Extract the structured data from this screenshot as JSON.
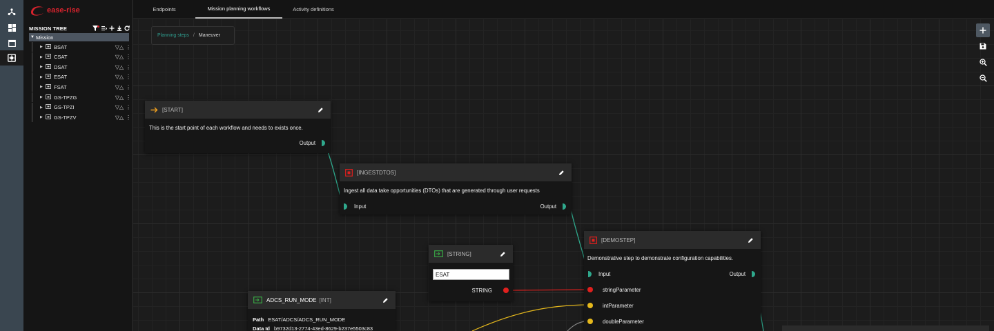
{
  "app": {
    "logo_text": "ease-rise",
    "brand_color": "#d9232d",
    "accent_color": "#2fa88c"
  },
  "rail": {
    "items": [
      {
        "icon": "hierarchy-icon",
        "active": false
      },
      {
        "icon": "dashboard-icon",
        "active": false
      },
      {
        "icon": "calendar-icon",
        "active": false
      },
      {
        "icon": "workflow-icon",
        "active": true
      }
    ]
  },
  "tree": {
    "title": "MISSION TREE",
    "root": "Mission",
    "items": [
      {
        "label": "BSAT"
      },
      {
        "label": "CSAT"
      },
      {
        "label": "DSAT"
      },
      {
        "label": "ESAT"
      },
      {
        "label": "FSAT"
      },
      {
        "label": "GS-TPZG"
      },
      {
        "label": "GS-TPZI"
      },
      {
        "label": "GS-TPZV"
      }
    ],
    "flag_glyphs": "▽△",
    "more_glyph": "⋮"
  },
  "tabs": [
    {
      "label": "Endpoints",
      "active": false
    },
    {
      "label": "Mission planning workflows",
      "active": true
    },
    {
      "label": "Activity definitions",
      "active": false
    }
  ],
  "breadcrumb": {
    "parent": "Planning steps",
    "separator": "/",
    "current": "Maneuver"
  },
  "nodes": {
    "start": {
      "title": "[START]",
      "description": "This is the start point of each workflow and needs to exists once.",
      "output": "Output"
    },
    "ingest": {
      "title": "[INGESTDTOS]",
      "description": "Ingest all data take opportunities (DTOs) that are generated through user requests",
      "input": "Input",
      "output": "Output"
    },
    "string": {
      "title": "[STRING]",
      "value": "ESAT",
      "output": "STRING"
    },
    "demostep": {
      "title": "[DEMOSTEP]",
      "description": "Demonstrative step to demonstrate configuration capabilities.",
      "input": "Input",
      "output": "Output",
      "params": [
        {
          "label": "stringParameter",
          "color": "#e0201e"
        },
        {
          "label": "intParameter",
          "color": "#e5b81c"
        },
        {
          "label": "doubleParameter",
          "color": "#e5b81c"
        }
      ]
    },
    "adcs": {
      "title": "ADCS_RUN_MODE",
      "type": "[INT]",
      "path_label": "Path",
      "path": "ESAT/ADCS/ADCS_RUN_MODE",
      "dataid_label": "Data Id",
      "dataid": "b9732d13-2774-43ed-8629-b237e5503c83"
    }
  }
}
